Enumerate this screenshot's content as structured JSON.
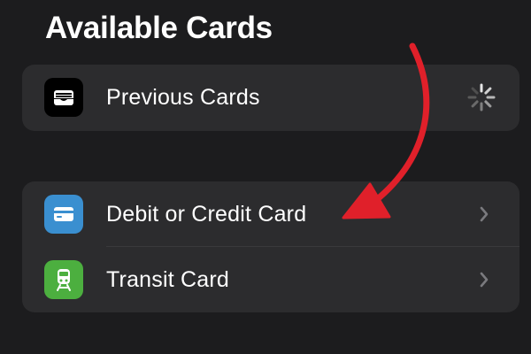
{
  "page": {
    "title": "Available Cards"
  },
  "sections": [
    {
      "rows": [
        {
          "label": "Previous Cards",
          "icon": "wallet-icon",
          "icon_bg": "#000000",
          "accessory": "loading-spinner"
        }
      ]
    },
    {
      "rows": [
        {
          "label": "Debit or Credit Card",
          "icon": "credit-card-icon",
          "icon_bg": "#3a8fd0",
          "accessory": "chevron-right"
        },
        {
          "label": "Transit Card",
          "icon": "train-icon",
          "icon_bg": "#4caf3f",
          "accessory": "chevron-right"
        }
      ]
    }
  ],
  "colors": {
    "background": "#1c1c1e",
    "group_background": "#2c2c2e",
    "annotation_arrow": "#e0202a"
  }
}
